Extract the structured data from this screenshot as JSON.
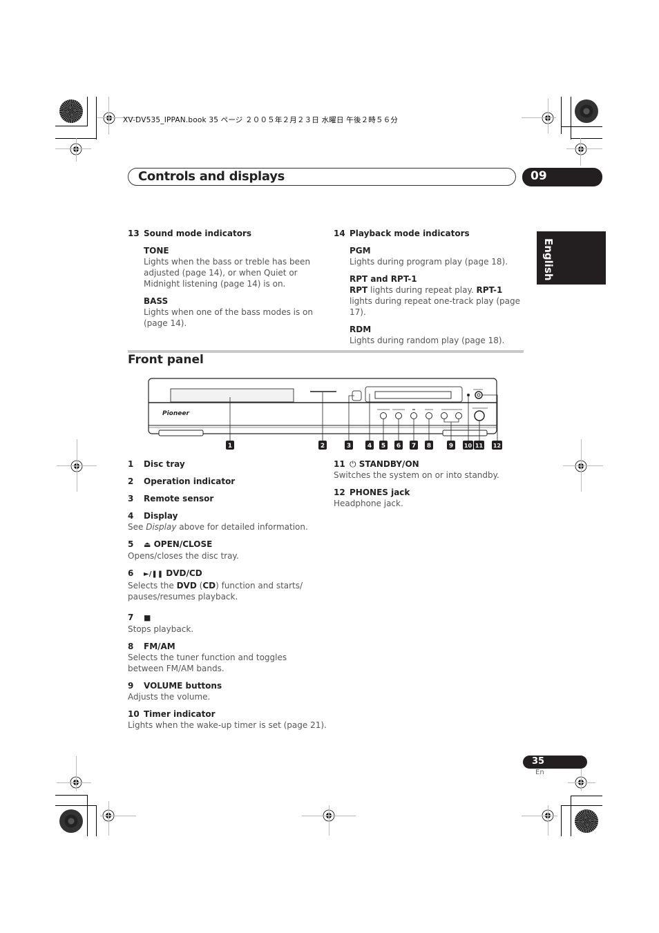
{
  "print_header": "XV-DV535_IPPAN.book  35 ページ  ２００５年２月２３日  水曜日  午後２時５６分",
  "chapter": {
    "title": "Controls and displays",
    "number": "09"
  },
  "language_tab": "English",
  "display_section": {
    "col_left": {
      "number": "13",
      "heading": "Sound mode indicators",
      "entries": [
        {
          "label": "TONE",
          "text": "Lights when the bass or treble has been adjusted (page 14), or when Quiet or Midnight listening (page 14) is on."
        },
        {
          "label": "BASS",
          "text": "Lights when one of the bass modes is on (page 14)."
        }
      ]
    },
    "col_right": {
      "number": "14",
      "heading": "Playback mode indicators",
      "entries": [
        {
          "label": "PGM",
          "text": "Lights during program play (page 18)."
        },
        {
          "label": "RPT and RPT-1",
          "text_parts": [
            "RPT",
            " lights during repeat play. ",
            "RPT-1",
            " lights during repeat one-track play (page 17)."
          ]
        },
        {
          "label": "RDM",
          "text": "Lights during random play (page 18)."
        }
      ]
    }
  },
  "front_panel": {
    "title": "Front panel",
    "diagram": {
      "brand": "Pioneer",
      "callouts": [
        "1",
        "2",
        "3",
        "4",
        "5",
        "6",
        "7",
        "8",
        "9",
        "10",
        "11",
        "12"
      ]
    },
    "items_left": [
      {
        "num": "1",
        "label": "Disc tray"
      },
      {
        "num": "2",
        "label": "Operation indicator"
      },
      {
        "num": "3",
        "label": "Remote sensor"
      },
      {
        "num": "4",
        "label": "Display",
        "desc_parts": [
          "See ",
          "Display",
          " above for detailed information."
        ]
      },
      {
        "num": "5",
        "icon": "⏏",
        "label": "OPEN/CLOSE",
        "desc": "Opens/closes the disc tray."
      },
      {
        "num": "6",
        "icon": "►/❚❚",
        "label": "DVD/CD",
        "desc_parts": [
          "Selects the ",
          "DVD",
          " (",
          "CD",
          ") function and starts/ pauses/resumes playback."
        ]
      },
      {
        "num": "7",
        "icon": "■",
        "label": "",
        "desc": "Stops playback."
      },
      {
        "num": "8",
        "label": "FM/AM",
        "desc": "Selects the tuner function and toggles between FM/AM bands."
      },
      {
        "num": "9",
        "label": "VOLUME buttons",
        "desc": "Adjusts the volume."
      },
      {
        "num": "10",
        "label": "Timer indicator",
        "desc": "Lights when the wake-up timer is set (page 21)."
      }
    ],
    "items_right": [
      {
        "num": "11",
        "icon": "⏻",
        "label": "STANDBY/ON",
        "desc": "Switches the system on or into standby."
      },
      {
        "num": "12",
        "label": "PHONES jack",
        "desc": "Headphone jack."
      }
    ]
  },
  "footer": {
    "page_number": "35",
    "page_lang": "En"
  }
}
